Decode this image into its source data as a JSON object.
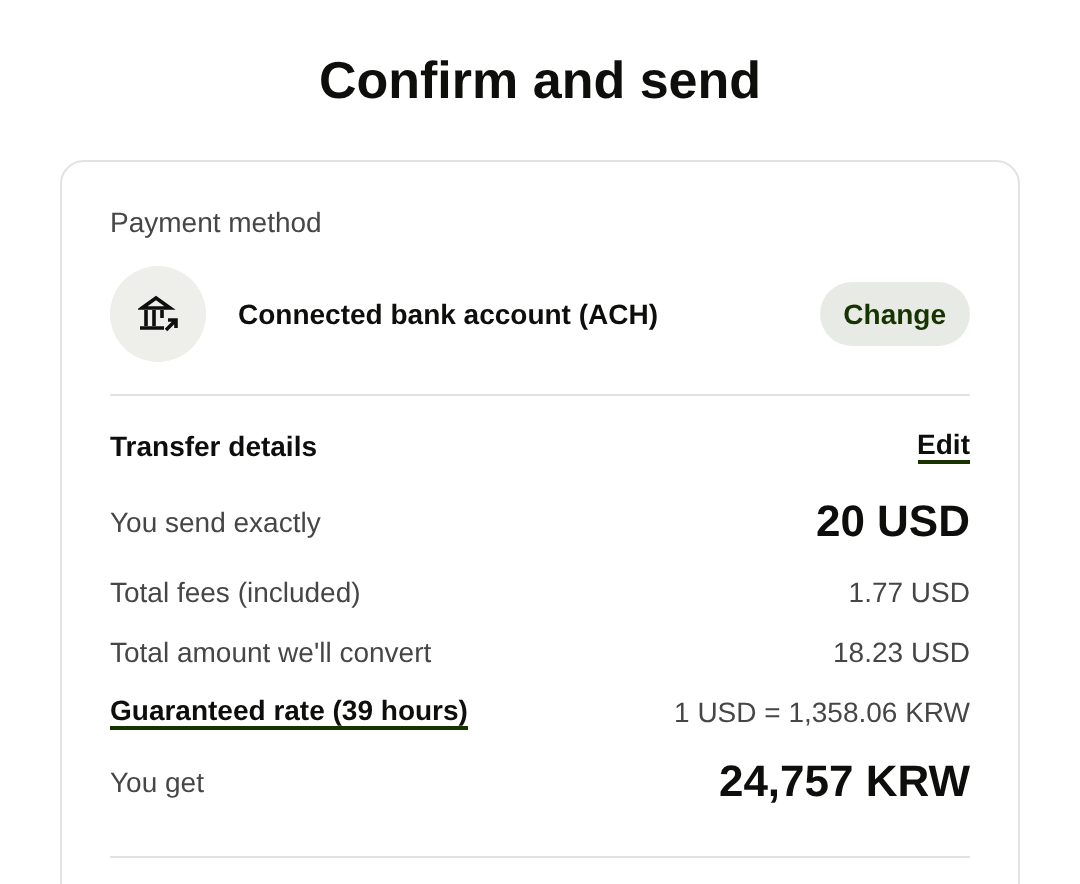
{
  "title": "Confirm and send",
  "payment_method": {
    "heading": "Payment method",
    "account": "Connected bank account (ACH)",
    "button": "Change"
  },
  "transfer_details": {
    "heading": "Transfer details",
    "edit": "Edit",
    "rows": [
      {
        "kind": "large",
        "label": "You send exactly",
        "value": "20 USD"
      },
      {
        "kind": "plain",
        "label": "Total fees (included)",
        "value": "1.77 USD"
      },
      {
        "kind": "plain",
        "label": "Total amount we'll convert",
        "value": "18.23 USD"
      },
      {
        "kind": "link",
        "label": "Guaranteed rate (39 hours)",
        "value": "1 USD = 1,358.06 KRW"
      },
      {
        "kind": "large",
        "label": "You get",
        "value": "24,757 KRW"
      }
    ]
  }
}
